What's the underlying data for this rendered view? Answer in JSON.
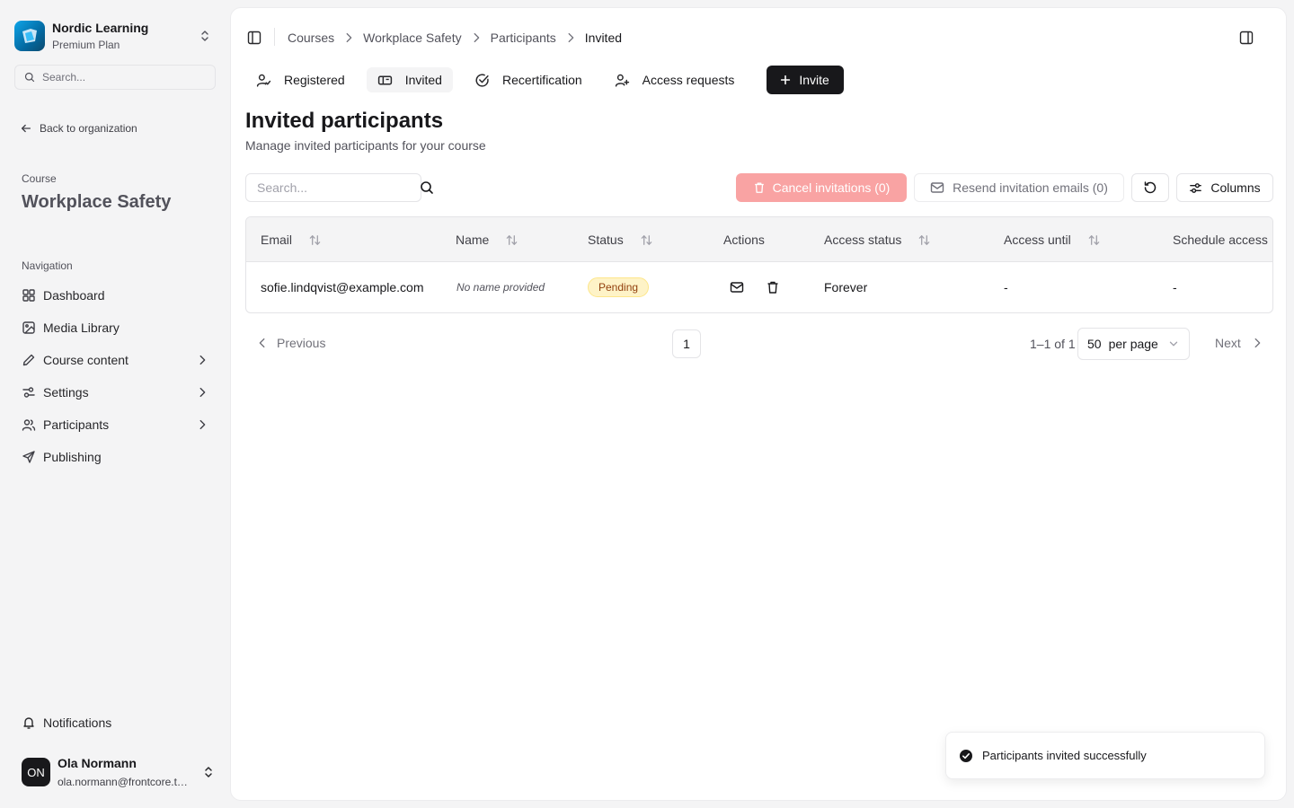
{
  "org": {
    "name": "Nordic Learning",
    "plan": "Premium Plan"
  },
  "sidebar": {
    "search_placeholder": "Search...",
    "back_label": "Back to organization",
    "course_label": "Course",
    "course_title": "Workplace Safety",
    "nav_label": "Navigation",
    "items": [
      {
        "label": "Dashboard",
        "icon": "dashboard-icon"
      },
      {
        "label": "Media Library",
        "icon": "image-icon"
      },
      {
        "label": "Course content",
        "icon": "pencil-icon",
        "expandable": true
      },
      {
        "label": "Settings",
        "icon": "settings-icon",
        "expandable": true
      },
      {
        "label": "Participants",
        "icon": "users-icon",
        "expandable": true
      },
      {
        "label": "Publishing",
        "icon": "send-icon"
      }
    ],
    "notifications_label": "Notifications"
  },
  "user": {
    "initials": "ON",
    "name": "Ola Normann",
    "email": "ola.normann@frontcore.tech"
  },
  "breadcrumb": [
    "Courses",
    "Workplace Safety",
    "Participants",
    "Invited"
  ],
  "tabs": [
    {
      "label": "Registered",
      "icon": "user-check-icon",
      "active": false
    },
    {
      "label": "Invited",
      "icon": "ticket-icon",
      "active": true
    },
    {
      "label": "Recertification",
      "icon": "circle-check-icon",
      "active": false
    },
    {
      "label": "Access requests",
      "icon": "user-plus-icon",
      "active": false
    }
  ],
  "invite_label": "Invite",
  "page": {
    "title": "Invited participants",
    "subtitle": "Manage invited participants for your course"
  },
  "toolbar": {
    "search_placeholder": "Search...",
    "cancel_label": "Cancel invitations (0)",
    "resend_label": "Resend invitation emails (0)",
    "columns_label": "Columns"
  },
  "table": {
    "headers": [
      "Email",
      "Name",
      "Status",
      "Actions",
      "Access status",
      "Access until",
      "Schedule access"
    ],
    "rows": [
      {
        "email": "sofie.lindqvist@example.com",
        "name": "No name provided",
        "status": "Pending",
        "access_status": "Forever",
        "access_until": "-",
        "schedule_access": "-"
      }
    ]
  },
  "pagination": {
    "previous": "Previous",
    "current_page": "1",
    "range": "1–1 of 1",
    "per_page_value": "50",
    "per_page_label": "per page",
    "next": "Next"
  },
  "toast": {
    "message": "Participants invited successfully"
  },
  "colors": {
    "primary": "#18181b",
    "destructive_disabled": "#f9a3a3",
    "pending_badge_bg": "#fef3c7",
    "pending_badge_text": "#92400e",
    "logo": "#0ea5e9"
  }
}
